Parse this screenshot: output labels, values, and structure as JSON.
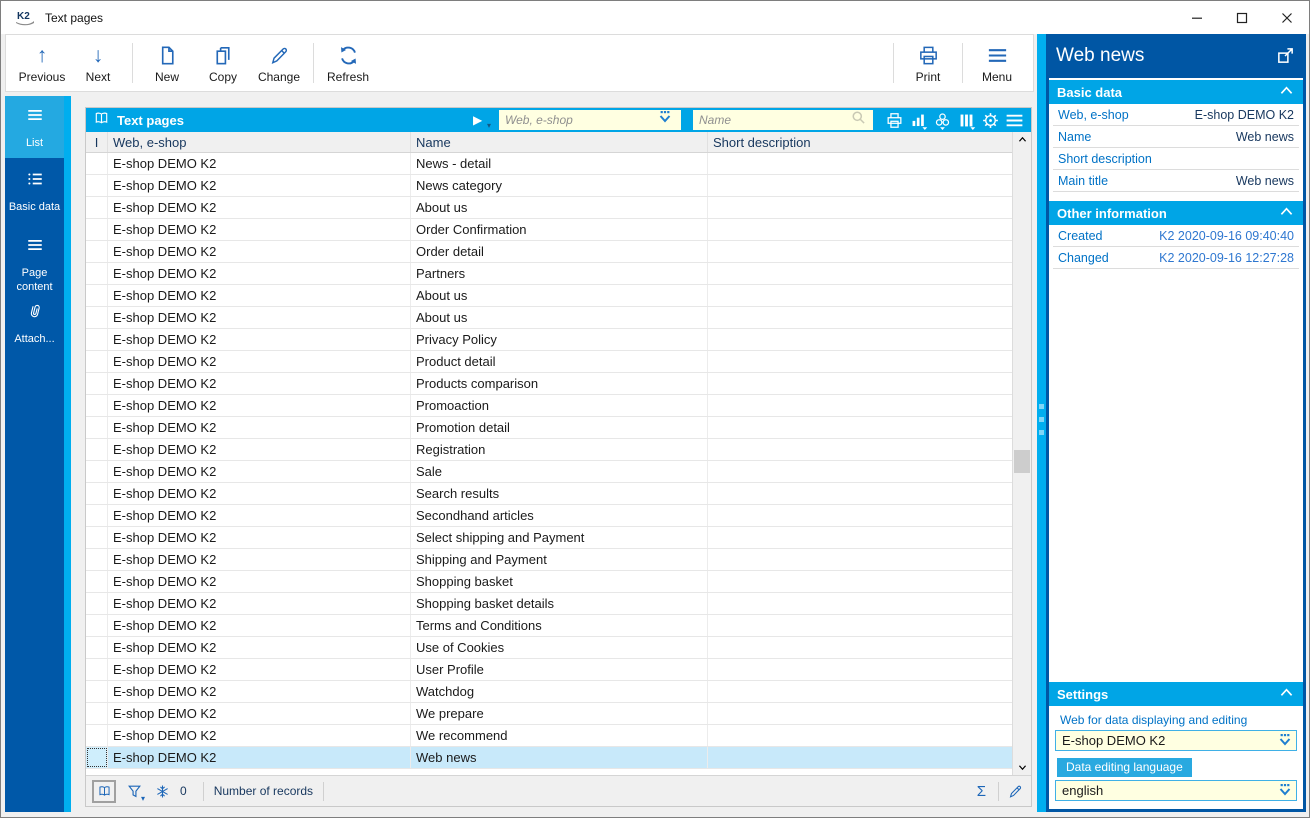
{
  "titlebar": {
    "title": "Text pages",
    "logo": "K2"
  },
  "toolbar": {
    "items": [
      {
        "label": "Previous"
      },
      {
        "label": "Next"
      },
      {
        "label": "New"
      },
      {
        "label": "Copy"
      },
      {
        "label": "Change"
      },
      {
        "label": "Refresh"
      },
      {
        "label": "Print"
      },
      {
        "label": "Menu"
      }
    ]
  },
  "sidebar": {
    "items": [
      {
        "label": "List",
        "active": true
      },
      {
        "label": "Basic data",
        "active": false
      },
      {
        "label": "Page content",
        "active": false
      },
      {
        "label": "Attach...",
        "active": false
      }
    ]
  },
  "table": {
    "panel_title": "Text pages",
    "filters": {
      "web_placeholder": "Web, e-shop",
      "name_placeholder": "Name"
    },
    "columns": [
      "I",
      "Web, e-shop",
      "Name",
      "Short description"
    ],
    "rows": [
      {
        "web": "E-shop DEMO K2",
        "name": "News - detail",
        "short_description": "",
        "selected": false
      },
      {
        "web": "E-shop DEMO K2",
        "name": "News category",
        "short_description": "",
        "selected": false
      },
      {
        "web": "E-shop DEMO K2",
        "name": "About us",
        "short_description": "",
        "selected": false
      },
      {
        "web": "E-shop DEMO K2",
        "name": "Order Confirmation",
        "short_description": "",
        "selected": false
      },
      {
        "web": "E-shop DEMO K2",
        "name": "Order detail",
        "short_description": "",
        "selected": false
      },
      {
        "web": "E-shop DEMO K2",
        "name": "Partners",
        "short_description": "",
        "selected": false
      },
      {
        "web": "E-shop DEMO K2",
        "name": "About us",
        "short_description": "",
        "selected": false
      },
      {
        "web": "E-shop DEMO K2",
        "name": "About us",
        "short_description": "",
        "selected": false
      },
      {
        "web": "E-shop DEMO K2",
        "name": "Privacy Policy",
        "short_description": "",
        "selected": false
      },
      {
        "web": "E-shop DEMO K2",
        "name": "Product detail",
        "short_description": "",
        "selected": false
      },
      {
        "web": "E-shop DEMO K2",
        "name": "Products comparison",
        "short_description": "",
        "selected": false
      },
      {
        "web": "E-shop DEMO K2",
        "name": "Promoaction",
        "short_description": "",
        "selected": false
      },
      {
        "web": "E-shop DEMO K2",
        "name": "Promotion detail",
        "short_description": "",
        "selected": false
      },
      {
        "web": "E-shop DEMO K2",
        "name": "Registration",
        "short_description": "",
        "selected": false
      },
      {
        "web": "E-shop DEMO K2",
        "name": "Sale",
        "short_description": "",
        "selected": false
      },
      {
        "web": "E-shop DEMO K2",
        "name": "Search results",
        "short_description": "",
        "selected": false
      },
      {
        "web": "E-shop DEMO K2",
        "name": "Secondhand articles",
        "short_description": "",
        "selected": false
      },
      {
        "web": "E-shop DEMO K2",
        "name": "Select shipping and Payment",
        "short_description": "",
        "selected": false
      },
      {
        "web": "E-shop DEMO K2",
        "name": "Shipping and Payment",
        "short_description": "",
        "selected": false
      },
      {
        "web": "E-shop DEMO K2",
        "name": "Shopping basket",
        "short_description": "",
        "selected": false
      },
      {
        "web": "E-shop DEMO K2",
        "name": "Shopping basket details",
        "short_description": "",
        "selected": false
      },
      {
        "web": "E-shop DEMO K2",
        "name": "Terms and Conditions",
        "short_description": "",
        "selected": false
      },
      {
        "web": "E-shop DEMO K2",
        "name": "Use of Cookies",
        "short_description": "",
        "selected": false
      },
      {
        "web": "E-shop DEMO K2",
        "name": "User Profile",
        "short_description": "",
        "selected": false
      },
      {
        "web": "E-shop DEMO K2",
        "name": "Watchdog",
        "short_description": "",
        "selected": false
      },
      {
        "web": "E-shop DEMO K2",
        "name": "We prepare",
        "short_description": "",
        "selected": false
      },
      {
        "web": "E-shop DEMO K2",
        "name": "We recommend",
        "short_description": "",
        "selected": false
      },
      {
        "web": "E-shop DEMO K2",
        "name": "Web news",
        "short_description": "",
        "selected": true
      }
    ]
  },
  "statusbar": {
    "frozen_count": "0",
    "records_label": "Number of records",
    "sigma": "Σ"
  },
  "detail_panel": {
    "title": "Web news",
    "sections": {
      "basic_data": {
        "title": "Basic data",
        "rows": [
          {
            "label": "Web, e-shop",
            "value": "E-shop DEMO K2"
          },
          {
            "label": "Name",
            "value": "Web news"
          },
          {
            "label": "Short description",
            "value": ""
          },
          {
            "label": "Main title",
            "value": "Web news"
          }
        ]
      },
      "other_information": {
        "title": "Other information",
        "rows": [
          {
            "label": "Created",
            "value": "K2 2020-09-16 09:40:40"
          },
          {
            "label": "Changed",
            "value": "K2 2020-09-16 12:27:28"
          }
        ]
      },
      "settings": {
        "title": "Settings",
        "fields": [
          {
            "label": "Web for data displaying and editing",
            "value": "E-shop DEMO K2",
            "label_highlighted": false
          },
          {
            "label": "Data editing language",
            "value": "english",
            "label_highlighted": true
          }
        ]
      }
    }
  },
  "colors": {
    "accent_cyan": "#00A5E6",
    "splitter_cyan": "#00AEEF",
    "sidebar_blue": "#0058A8",
    "panel_blue": "#0056A4",
    "active_tab_cyan": "#24A9E1",
    "icon_blue": "#2368B8",
    "label_blue": "#0072C6",
    "value_navy": "#17375E",
    "selected_row": "#C8E9FA",
    "input_yellow": "#FFFFE1"
  }
}
